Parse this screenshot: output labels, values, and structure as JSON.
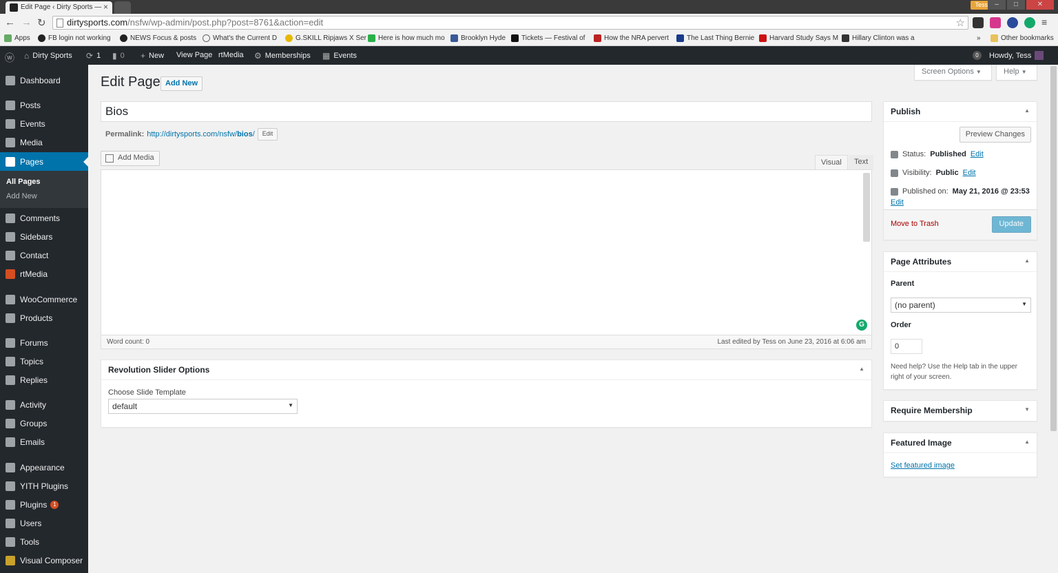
{
  "browser": {
    "active_tab_title": "Edit Page ‹ Dirty Sports —",
    "url_host": "dirtysports.com",
    "url_rest": "/nsfw/wp-admin/post.php?post=8761&action=edit",
    "profile_badge": "Tess",
    "bookmarks": [
      "Apps",
      "FB login not working",
      "NEWS Focus & posts",
      "What's the Current D",
      "G.SKILL Ripjaws X Ser",
      "Here is how much mo",
      "Brooklyn Hyde",
      "Tickets — Festival of",
      "How the NRA pervert",
      "The Last Thing Bernie",
      "Harvard Study Says M",
      "Hillary Clinton was a"
    ],
    "bookmarks_overflow": "»",
    "other_bookmarks": "Other bookmarks"
  },
  "adminbar": {
    "site_name": "Dirty Sports",
    "updates_count": "1",
    "comments_count": "0",
    "new_label": "New",
    "view_page": "View Page",
    "rtmedia": "rtMedia",
    "memberships": "Memberships",
    "events": "Events",
    "notif_count": "0",
    "howdy": "Howdy, Tess"
  },
  "menu": {
    "items": [
      "Dashboard",
      "Posts",
      "Events",
      "Media",
      "Pages",
      "Comments",
      "Sidebars",
      "Contact",
      "rtMedia",
      "WooCommerce",
      "Products",
      "Forums",
      "Topics",
      "Replies",
      "Activity",
      "Groups",
      "Emails",
      "Appearance",
      "YITH Plugins",
      "Plugins",
      "Users",
      "Tools",
      "Visual Composer"
    ],
    "plugins_badge": "1",
    "pages_submenu": [
      "All Pages",
      "Add New"
    ]
  },
  "screen_meta": {
    "screen_options": "Screen Options",
    "help": "Help"
  },
  "heading": {
    "title": "Edit Page",
    "add_new": "Add New"
  },
  "post": {
    "title": "Bios",
    "permalink_label": "Permalink:",
    "permalink_base": "http://dirtysports.com/nsfw/",
    "permalink_slug": "bios",
    "permalink_end": "/",
    "permalink_edit": "Edit"
  },
  "editor": {
    "add_media": "Add Media",
    "tab_visual": "Visual",
    "tab_text": "Text",
    "word_count": "Word count: 0",
    "last_edited": "Last edited by Tess on June 23, 2016 at 6:06 am"
  },
  "rev_slider": {
    "title": "Revolution Slider Options",
    "label": "Choose Slide Template",
    "value": "default"
  },
  "publish": {
    "title": "Publish",
    "preview": "Preview Changes",
    "status_label": "Status:",
    "status_value": "Published",
    "visibility_label": "Visibility:",
    "visibility_value": "Public",
    "published_label": "Published on:",
    "published_value": "May 21, 2016 @ 23:53",
    "edit": "Edit",
    "trash": "Move to Trash",
    "update": "Update"
  },
  "attributes": {
    "title": "Page Attributes",
    "parent_label": "Parent",
    "parent_value": "(no parent)",
    "order_label": "Order",
    "order_value": "0",
    "help": "Need help? Use the Help tab in the upper right of your screen."
  },
  "membership": {
    "title": "Require Membership"
  },
  "featured": {
    "title": "Featured Image",
    "set_link": "Set featured image"
  },
  "colors": {
    "admin_dark": "#23282d",
    "accent": "#0073aa",
    "primary_btn": "#0085ba",
    "trash": "#a00000"
  }
}
